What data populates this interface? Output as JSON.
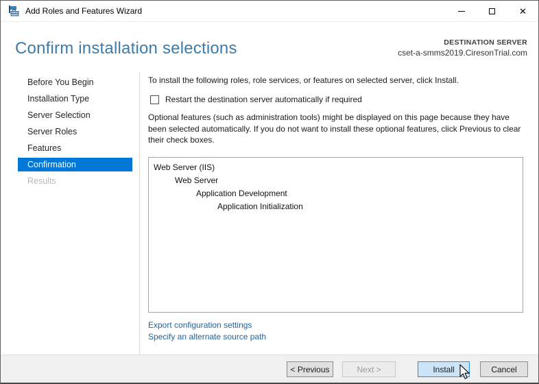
{
  "window": {
    "title": "Add Roles and Features Wizard"
  },
  "header": {
    "title": "Confirm installation selections",
    "destination_label": "DESTINATION SERVER",
    "destination_server": "cset-a-smms2019.CiresonTrial.com"
  },
  "sidebar": {
    "items": [
      {
        "label": "Before You Begin",
        "state": "normal"
      },
      {
        "label": "Installation Type",
        "state": "normal"
      },
      {
        "label": "Server Selection",
        "state": "normal"
      },
      {
        "label": "Server Roles",
        "state": "normal"
      },
      {
        "label": "Features",
        "state": "normal"
      },
      {
        "label": "Confirmation",
        "state": "selected"
      },
      {
        "label": "Results",
        "state": "disabled"
      }
    ]
  },
  "main": {
    "instruction": "To install the following roles, role services, or features on selected server, click Install.",
    "restart_checkbox": {
      "label": "Restart the destination server automatically if required",
      "checked": false
    },
    "optional_note": "Optional features (such as administration tools) might be displayed on this page because they have been selected automatically. If you do not want to install these optional features, click Previous to clear their check boxes.",
    "selection_tree": [
      {
        "label": "Web Server (IIS)",
        "level": 0
      },
      {
        "label": "Web Server",
        "level": 1
      },
      {
        "label": "Application Development",
        "level": 2
      },
      {
        "label": "Application Initialization",
        "level": 3
      }
    ],
    "links": [
      {
        "label": "Export configuration settings"
      },
      {
        "label": "Specify an alternate source path"
      }
    ]
  },
  "footer": {
    "previous": "< Previous",
    "next": "Next >",
    "install": "Install",
    "cancel": "Cancel"
  },
  "colors": {
    "accent": "#0078d7",
    "heading": "#3d7bab",
    "link": "#23639c",
    "install_button_bg": "#cce4f7",
    "selected_nav_bg": "#0078d7"
  }
}
